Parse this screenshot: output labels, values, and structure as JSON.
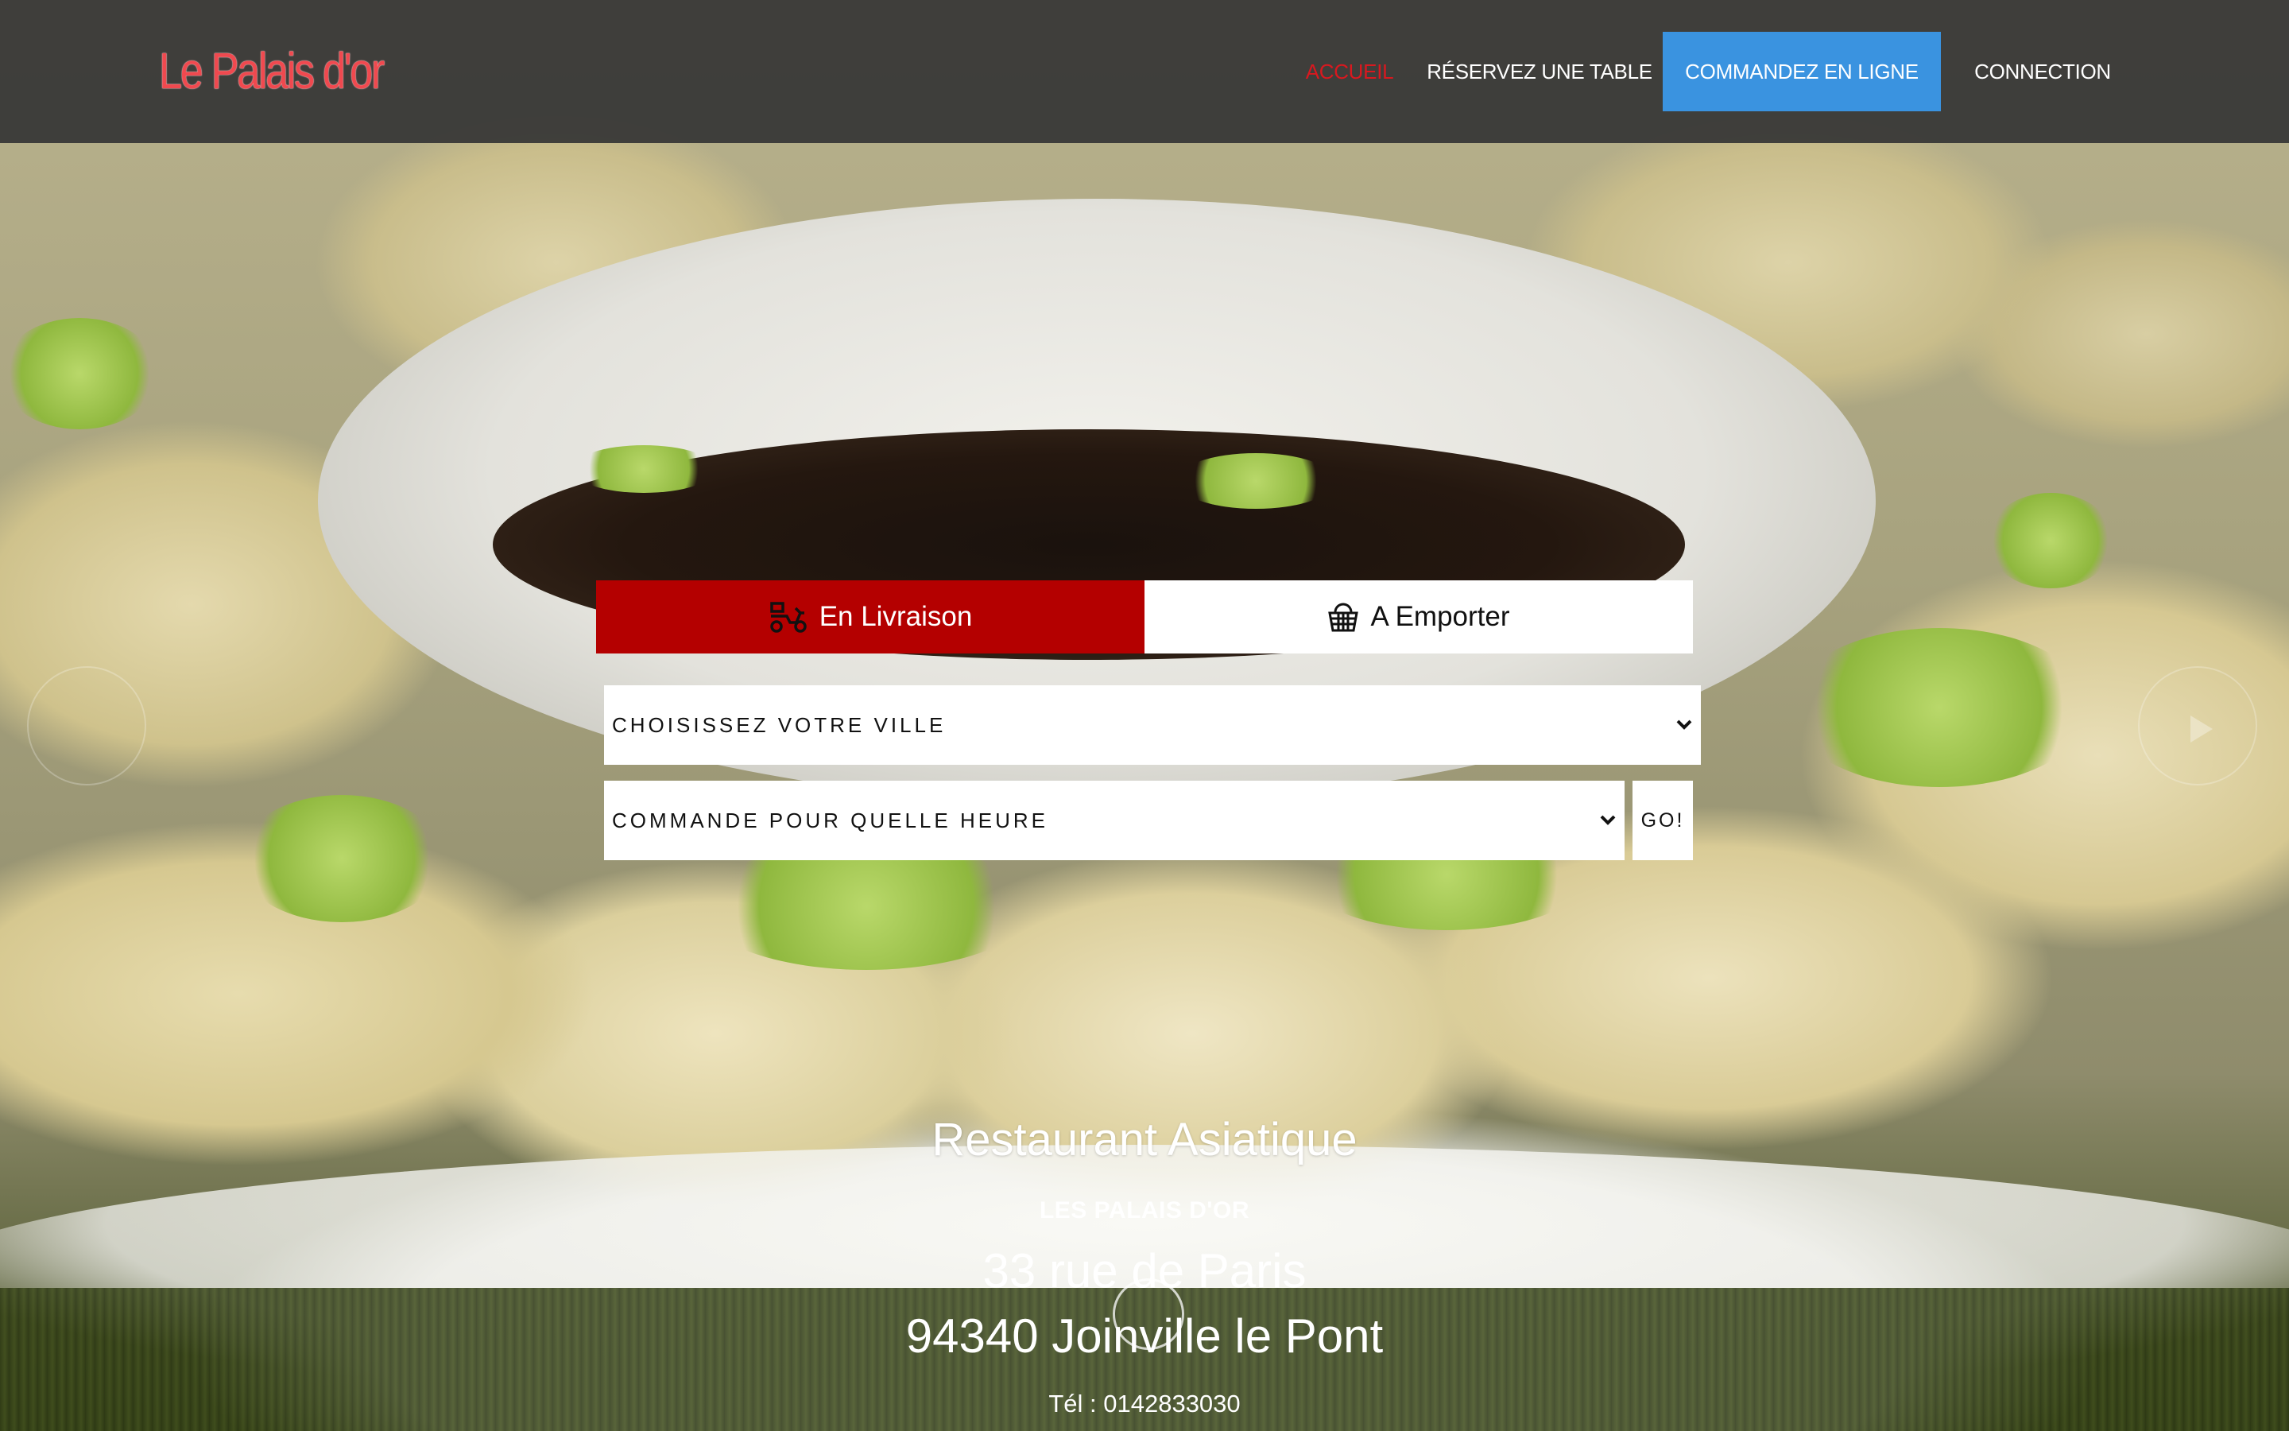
{
  "brand": {
    "logo_text": "Le Palais d'or"
  },
  "nav": {
    "items": [
      {
        "label": "ACCUEIL",
        "active": true
      },
      {
        "label": "RÉSERVEZ UNE TABLE"
      },
      {
        "label": "COMMANDEZ EN LIGNE",
        "highlighted": true
      },
      {
        "label": "CONNECTION"
      }
    ]
  },
  "order": {
    "tabs": [
      {
        "label": "En Livraison",
        "icon": "scooter-icon",
        "active": true
      },
      {
        "label": "A Emporter",
        "icon": "basket-icon"
      }
    ],
    "city_select": {
      "selected": "CHOISISSEZ VOTRE VILLE"
    },
    "time_select": {
      "selected": "COMMANDE POUR QUELLE HEURE"
    },
    "go_label": "GO!"
  },
  "info": {
    "title": "Restaurant Asiatique",
    "name": "LES PALAIS D'OR",
    "street": "33 rue de Paris",
    "city": "94340 Joinville le Pont",
    "phone": "Tél : 0142833030"
  },
  "colors": {
    "header_bg": "#343434",
    "active_nav": "#d9181f",
    "order_button": "#3a93e0",
    "delivery_tab": "#b40000",
    "logo": "#f0494f"
  }
}
